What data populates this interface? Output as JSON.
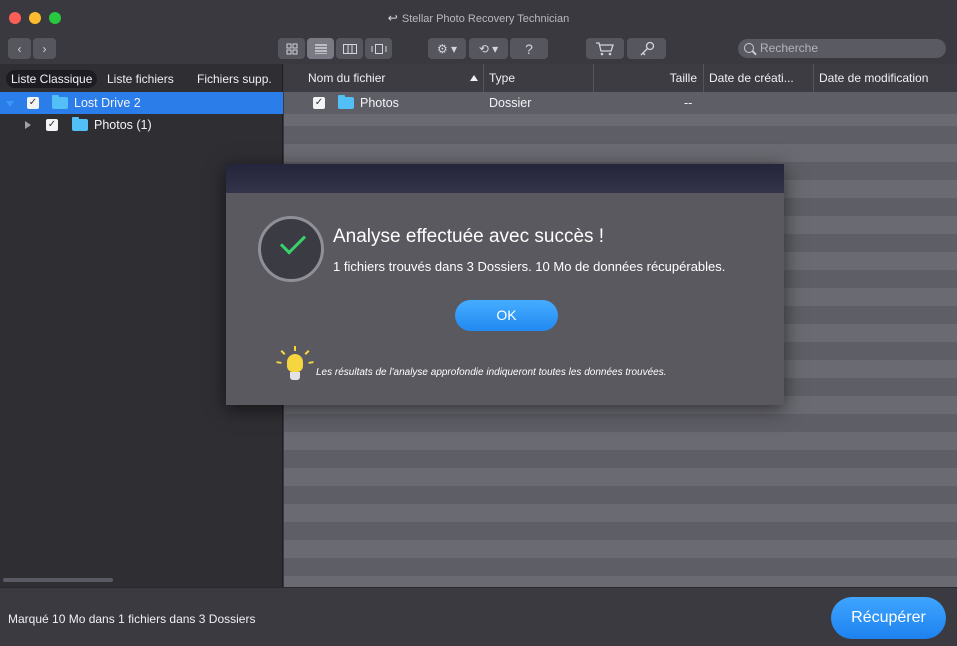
{
  "window": {
    "title": "Stellar Photo Recovery Technician",
    "back_glyph": "↩"
  },
  "toolbar": {
    "back_icon": "‹",
    "forward_icon": "›",
    "views": [
      "grid-view-icon",
      "list-view-icon",
      "column-view-icon",
      "coverflow-view-icon"
    ],
    "gear_icon": "⚙ ▾",
    "history_icon": "⟲ ▾",
    "help_label": "?",
    "cart_icon": "🛒",
    "key_icon": "🔑",
    "search_placeholder": "Recherche"
  },
  "sidebar": {
    "tabs": [
      "Liste Classique",
      "Liste fichiers",
      "Fichiers supp."
    ],
    "tree": [
      {
        "label": "Lost Drive 2",
        "checked": "✓"
      },
      {
        "label": "Photos (1)",
        "checked": "✓"
      }
    ]
  },
  "table": {
    "columns": [
      "Nom du fichier",
      "Type",
      "Taille",
      "Date de créati...",
      "Date de modification"
    ],
    "rows": [
      {
        "name": "Photos",
        "type": "Dossier",
        "size": "--",
        "checked": "✓"
      }
    ]
  },
  "modal": {
    "title": "Analyse effectuée avec succès !",
    "subtitle": "1 fichiers trouvés dans 3 Dossiers. 10  Mo de données récupérables.",
    "ok_label": "OK",
    "tip": "Les résultats de l'analyse approfondie indiqueront toutes les données trouvées."
  },
  "status": {
    "text": "Marqué 10  Mo dans 1 fichiers dans 3 Dossiers",
    "recover_label": "Récupérer"
  },
  "colors": {
    "accent": "#2b7de9",
    "success": "#39d16b",
    "bulb": "#f6d63e"
  }
}
